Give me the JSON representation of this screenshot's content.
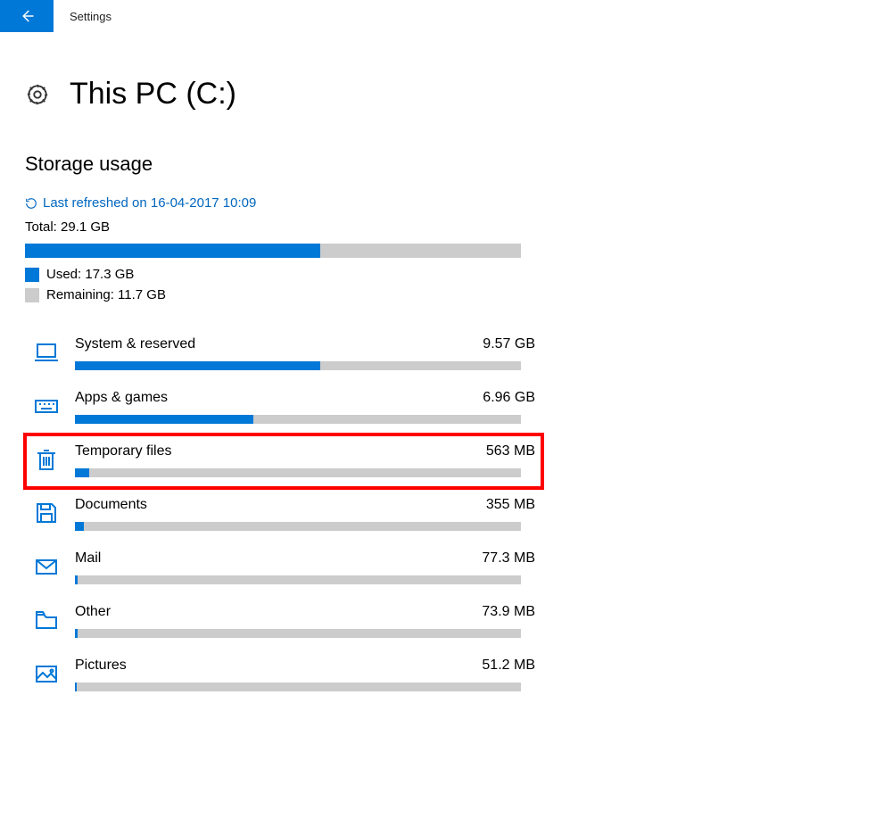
{
  "window_title": "Settings",
  "page_title": "This PC (C:)",
  "section_title": "Storage usage",
  "refresh_text": "Last refreshed on 16-04-2017 10:09",
  "total_label": "Total: 29.1 GB",
  "used_label": "Used: 17.3 GB",
  "remaining_label": "Remaining: 11.7 GB",
  "total_bar_percent": 59.5,
  "categories": [
    {
      "name": "System & reserved",
      "size": "9.57 GB",
      "percent": 55
    },
    {
      "name": "Apps & games",
      "size": "6.96 GB",
      "percent": 40
    },
    {
      "name": "Temporary files",
      "size": "563 MB",
      "percent": 3.2,
      "highlight": true
    },
    {
      "name": "Documents",
      "size": "355 MB",
      "percent": 2
    },
    {
      "name": "Mail",
      "size": "77.3 MB",
      "percent": 0.5
    },
    {
      "name": "Other",
      "size": "73.9 MB",
      "percent": 0.5
    },
    {
      "name": "Pictures",
      "size": "51.2 MB",
      "percent": 0.4
    }
  ]
}
